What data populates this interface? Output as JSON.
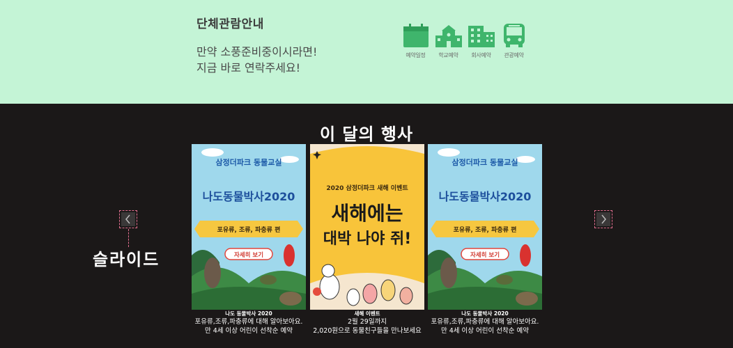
{
  "group": {
    "title": "단체관람안내",
    "desc_line1": "만약 소풍준비중이시라면!",
    "desc_line2": "지금 바로 연락주세요!",
    "icons": [
      {
        "icon": "calendar-icon",
        "label": "예약일정"
      },
      {
        "icon": "school-icon",
        "label": "학교예약"
      },
      {
        "icon": "building-icon",
        "label": "회사예약"
      },
      {
        "icon": "bus-icon",
        "label": "관광예약"
      }
    ],
    "accent_color": "#3fb56c"
  },
  "events": {
    "title": "이 달의 행사",
    "slide_label": "슬라이드",
    "callout_color": "#e06e8e",
    "cards": [
      {
        "poster": {
          "top": "삼정더파크 동물교실",
          "headline": "나도동물박사2020",
          "ribbon": "포유류, 조류, 파충류 편",
          "button": "자세히 보기"
        },
        "caption_title": "나도 동물박사 2020",
        "caption_line1": "포유류,조류,파충류에 대해 알아보아요.",
        "caption_line2": "만 4세 이상 어린이 선착순 예약"
      },
      {
        "poster": {
          "top": "2020 삼정더파크 새해 이벤트",
          "headline_line1": "새해에는",
          "headline_line2": "대박 나야 쥐!"
        },
        "caption_title": "새해 이벤트",
        "caption_line1": "2월 29일까지",
        "caption_line2": "2,020원으로 동물친구들을 만나보세요"
      },
      {
        "poster": {
          "top": "삼정더파크 동물교실",
          "headline": "나도동물박사2020",
          "ribbon": "포유류, 조류, 파충류 편",
          "button": "자세히 보기"
        },
        "caption_title": "나도 동물박사 2020",
        "caption_line1": "포유류,조류,파충류에 대해 알아보아요.",
        "caption_line2": "만 4세 이상 어린이 선착순 예약"
      }
    ]
  }
}
